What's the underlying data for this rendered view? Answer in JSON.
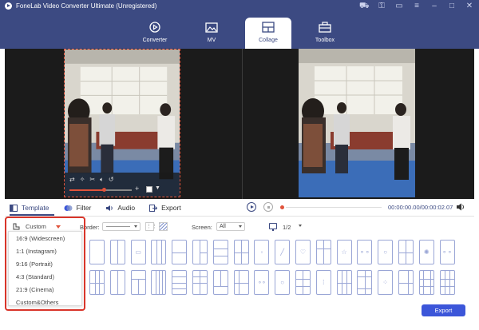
{
  "app": {
    "title": "FoneLab Video Converter Ultimate (Unregistered)"
  },
  "nav": {
    "tabs": [
      {
        "label": "Converter",
        "icon": "converter-icon"
      },
      {
        "label": "MV",
        "icon": "mv-icon"
      },
      {
        "label": "Collage",
        "icon": "collage-icon",
        "active": true
      },
      {
        "label": "Toolbox",
        "icon": "toolbox-icon"
      }
    ]
  },
  "window_controls": [
    "cart-icon",
    "key-icon",
    "feedback-icon",
    "menu-icon",
    "minimize-icon",
    "maximize-icon",
    "close-icon"
  ],
  "panel_tabs": [
    {
      "label": "Template",
      "active": true
    },
    {
      "label": "Filter"
    },
    {
      "label": "Audio"
    },
    {
      "label": "Export"
    }
  ],
  "playback": {
    "timecode": "00:00:00.00/00:00:02.07"
  },
  "controls": {
    "aspect_value": "Custom",
    "border_label": "Border:",
    "screen_label": "Screen:",
    "screen_value": "All",
    "page_value": "1/2"
  },
  "aspect_options": [
    "16:9 (Widescreen)",
    "1:1 (Instagram)",
    "9:16 (Portrait)",
    "4:3 (Standard)",
    "21:9 (Cinema)",
    "Custom&Others"
  ],
  "export_button": "Export",
  "colors": {
    "brand": "#3c4a82",
    "accent": "#e0533b",
    "export": "#3c56d9",
    "template_stroke": "#9aa6d6"
  }
}
